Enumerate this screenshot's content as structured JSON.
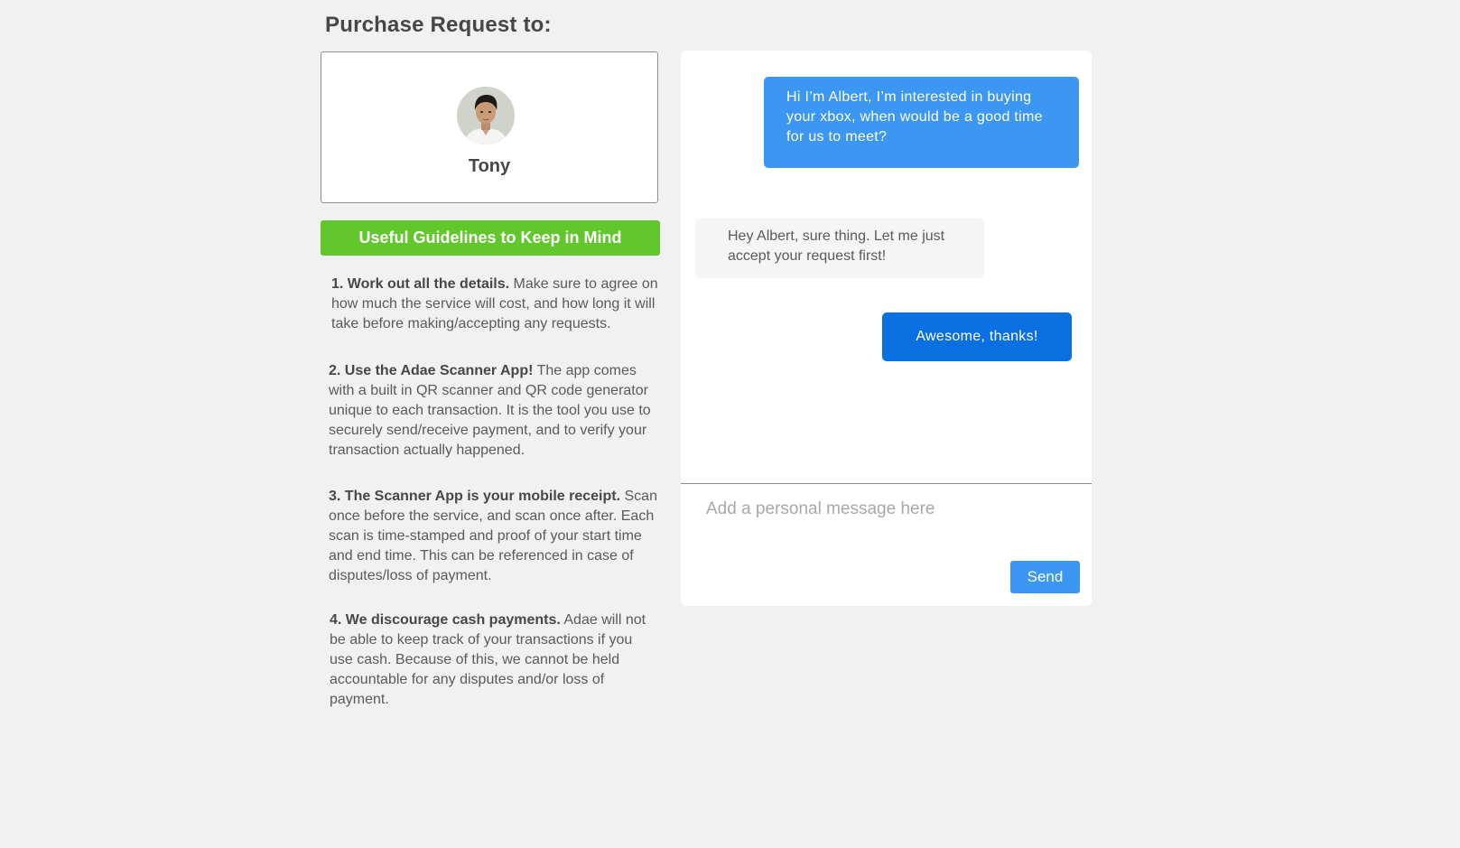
{
  "header": {
    "title": "Purchase Request to:"
  },
  "recipient": {
    "name": "Tony",
    "avatar_icon": "user-avatar-photo"
  },
  "guidelines": {
    "button_label": "Useful Guidelines to Keep in Mind",
    "items": [
      {
        "title": "1. Work out all the details.",
        "text": "Make sure to agree on how much the service will cost, and how long it will take before making/accepting any requests."
      },
      {
        "title": "2. Use the Adae Scanner App!",
        "text": "The app comes with a built in QR scanner and QR code generator unique to each transaction. It is the tool you use to securely send/receive payment, and to verify your transaction actually happened."
      },
      {
        "title": "3. The Scanner App is your mobile receipt.",
        "text": "Scan once before the service, and scan once after. Each scan is time-stamped and proof of your start time and end time. This can be referenced in case of disputes/loss of payment."
      },
      {
        "title": "4. We discourage cash payments.",
        "text": "Adae will not be able to keep track of your transactions if you use cash. Because of this, we cannot be held accountable for any disputes and/or loss of payment."
      }
    ]
  },
  "chat": {
    "messages": [
      {
        "sender": "me",
        "text": "Hi I’m Albert, I’m interested in buying your xbox, when would be a good time for us to meet?"
      },
      {
        "sender": "them",
        "text": "Hey Albert, sure thing. Let me just accept your request first!"
      },
      {
        "sender": "me",
        "text": "Awesome, thanks!"
      }
    ],
    "input_placeholder": "Add a personal message here",
    "input_value": "",
    "send_label": "Send"
  },
  "colors": {
    "background": "#f1f1f1",
    "guidelines_green": "#62c72c",
    "bubble_blue": "#3c97f2",
    "bubble_blue_dark": "#0a6fe0",
    "bubble_gray": "#f5f5f5"
  }
}
